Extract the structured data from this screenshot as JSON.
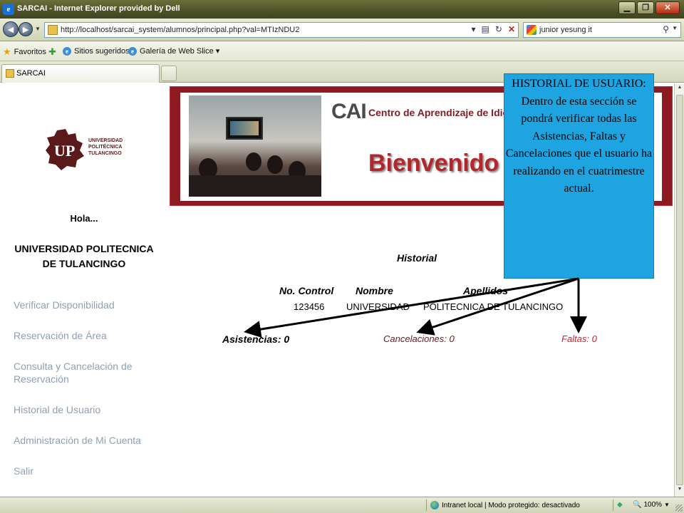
{
  "window": {
    "title": "SARCAI - Internet Explorer provided by Dell",
    "minimize": "▁",
    "maximize": "❐",
    "close": "✕"
  },
  "address": {
    "url": "http://localhost/sarcai_system/alumnos/principal.php?val=MTIzNDU2",
    "search_query": "junior yesung it"
  },
  "favorites_bar": {
    "favorites": "Favoritos",
    "suggested": "Sitios sugeridos ▾",
    "gallery": "Galería de Web Slice ▾"
  },
  "tabs": [
    {
      "label": "SARCAI"
    }
  ],
  "sidebar": {
    "logo_text": [
      "UNIVERSIDAD",
      "POLITÉCNICA",
      "TULANCINGO"
    ],
    "greeting": "Hola...",
    "user_name": "UNIVERSIDAD POLITECNICA DE TULANCINGO",
    "menu": [
      {
        "label": "Verificar Disponibilidad"
      },
      {
        "label": "Reservación de Área"
      },
      {
        "label": "Consulta y Cancelación de Reservación"
      },
      {
        "label": "Historial de Usuario"
      },
      {
        "label": "Administración de Mi Cuenta"
      },
      {
        "label": "Salir"
      }
    ]
  },
  "banner": {
    "logo": "CAI",
    "center_name": "Centro de Aprendizaje de Idiom",
    "welcome": "Bienvenido"
  },
  "history": {
    "title": "Historial",
    "columns": [
      "No. Control",
      "Nombre",
      "Apellidos"
    ],
    "row": [
      "123456",
      "UNIVERSIDAD",
      "POLITECNICA DE TULANCINGO"
    ],
    "asistencias": "Asistencias: 0",
    "cancelaciones": "Cancelaciones: 0",
    "faltas": "Faltas: 0"
  },
  "callout": {
    "text": "HISTORIAL DE USUARIO: Dentro de esta sección se pondrá verificar todas las Asistencias, Faltas y Cancelaciones que el usuario ha realizando en el cuatrimestre actual."
  },
  "statusbar": {
    "zone": "Intranet local | Modo protegido: desactivado",
    "zoom": "100%"
  },
  "colors": {
    "accent_maroon": "#8d1a20",
    "menu_link": "#8e9fb4",
    "callout_bg": "#1ea4e0",
    "faltas_red": "#d4202a"
  }
}
